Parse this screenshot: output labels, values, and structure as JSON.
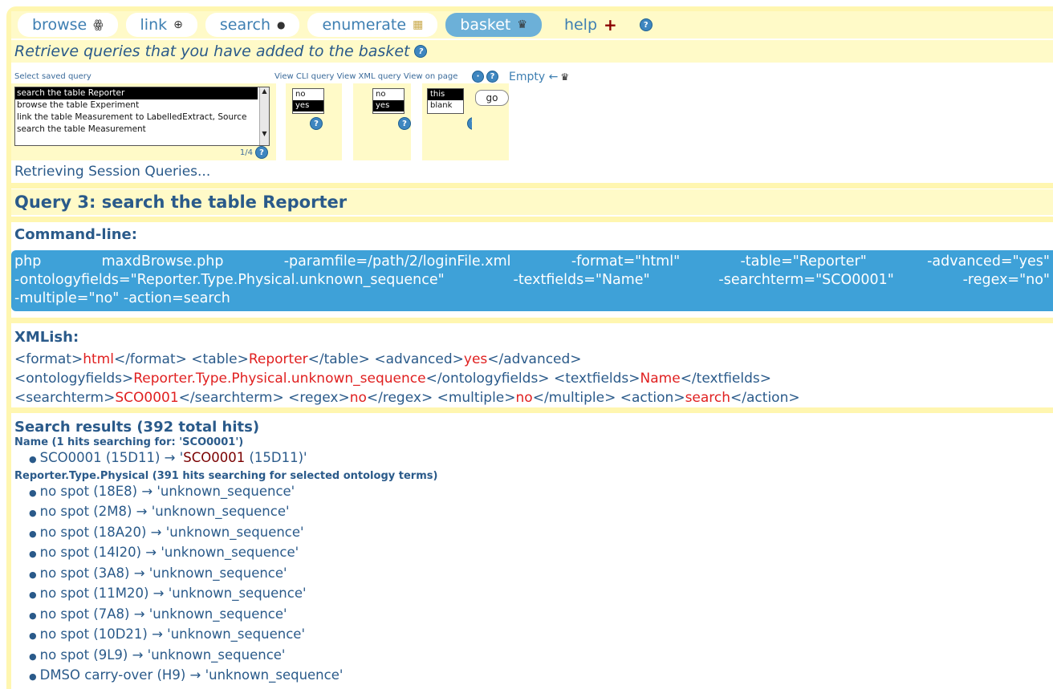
{
  "nav": {
    "items": [
      {
        "label": "browse",
        "icon": "spectacles-icon",
        "glyph": "ꙮ"
      },
      {
        "label": "link",
        "icon": "link-icon",
        "glyph": "⊕"
      },
      {
        "label": "search",
        "icon": "magnifier-icon",
        "glyph": "🔍"
      },
      {
        "label": "enumerate",
        "icon": "grid-icon",
        "glyph": "▦"
      },
      {
        "label": "basket",
        "icon": "basket-icon",
        "glyph": "♛"
      },
      {
        "label": "help",
        "icon": "plus-icon",
        "glyph": "✚"
      }
    ],
    "active": "basket",
    "help_badge": "?"
  },
  "intro": {
    "text": "Retrieve queries that you have added to the basket",
    "help": "?"
  },
  "picker": {
    "label": "Select saved query",
    "options": [
      "search the table Reporter",
      "browse the table Experiment",
      "link the table Measurement to LabelledExtract, Source",
      "search the table Measurement"
    ],
    "selected_index": 0,
    "counter": "1/4",
    "help": "?",
    "col_labels": "View CLI query View XML query View on page",
    "cli_options": [
      "no",
      "yes"
    ],
    "cli_selected": "yes",
    "xml_options": [
      "no",
      "yes"
    ],
    "xml_selected": "yes",
    "page_options": [
      "this",
      "blank"
    ],
    "page_selected": "this",
    "go_label": "go",
    "empty_label": "Empty ←"
  },
  "status": "Retrieving Session Queries...",
  "query": {
    "title": "Query 3: search the table Reporter",
    "cli_heading": "Command-line:",
    "cli_lines": [
      [
        "php",
        "maxdBrowse.php",
        "-paramfile=/path/2/loginFile.xml",
        "-format=\"html\"",
        "-table=\"Reporter\"",
        "-advanced=\"yes\""
      ],
      [
        "-ontologyfields=\"Reporter.Type.Physical.unknown_sequence\"",
        "-textfields=\"Name\"",
        "-searchterm=\"SCO0001\"",
        "-regex=\"no\""
      ],
      [
        "-multiple=\"no\" -action=search"
      ]
    ],
    "xml_heading": "XMLish:",
    "xml": {
      "format": "html",
      "table": "Reporter",
      "advanced": "yes",
      "ontologyfields": "Reporter.Type.Physical.unknown_sequence",
      "textfields": "Name",
      "searchterm": "SCO0001",
      "regex": "no",
      "multiple": "no",
      "action": "search"
    }
  },
  "results": {
    "title": "Search results (392 total hits)",
    "groups": [
      {
        "heading": "Name (1 hits searching for: 'SCO0001')",
        "items": [
          {
            "text": "SCO0001 (15D11) → '",
            "highlight": "SCO0001",
            "rest": " (15D11)'"
          }
        ]
      },
      {
        "heading": "Reporter.Type.Physical (391 hits searching for selected ontology terms)",
        "items": [
          {
            "text": "no spot (18E8) → 'unknown_sequence'"
          },
          {
            "text": "no spot (2M8) → 'unknown_sequence'"
          },
          {
            "text": "no spot (18A20) → 'unknown_sequence'"
          },
          {
            "text": "no spot (14I20) → 'unknown_sequence'"
          },
          {
            "text": "no spot (3A8) → 'unknown_sequence'"
          },
          {
            "text": "no spot (11M20) → 'unknown_sequence'"
          },
          {
            "text": "no spot (7A8) → 'unknown_sequence'"
          },
          {
            "text": "no spot (10D21) → 'unknown_sequence'"
          },
          {
            "text": "no spot (9L9) → 'unknown_sequence'"
          },
          {
            "text": "DMSO carry-over (H9) → 'unknown_sequence'"
          }
        ]
      }
    ]
  },
  "colors": {
    "accent": "#3ea1d8",
    "band": "#fffac8",
    "text": "#2a5a8a",
    "value": "#e02020"
  }
}
